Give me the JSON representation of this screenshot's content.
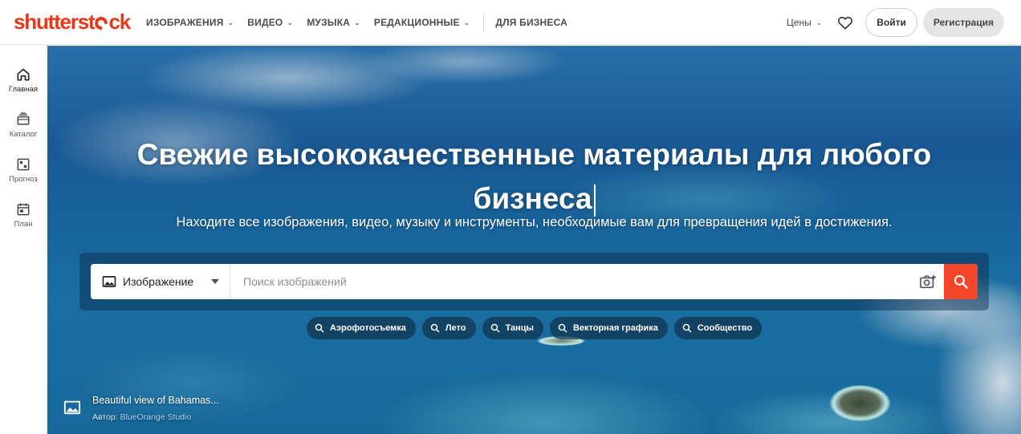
{
  "brand": {
    "logo_pre": "shutterst",
    "logo_post": "ck",
    "accent": "#e8381c"
  },
  "nav": {
    "items": [
      {
        "label": "ИЗОБРАЖЕНИЯ",
        "has_dropdown": true
      },
      {
        "label": "ВИДЕО",
        "has_dropdown": true
      },
      {
        "label": "МУЗЫКА",
        "has_dropdown": true
      },
      {
        "label": "РЕДАКЦИОННЫЕ",
        "has_dropdown": true
      },
      {
        "label": "ДЛЯ БИЗНЕСА",
        "has_dropdown": false
      }
    ],
    "prices_label": "Цены",
    "favorites_icon": "heart-icon",
    "login_label": "Войти",
    "register_label": "Регистрация"
  },
  "sidebar": {
    "items": [
      {
        "label": "Главная",
        "icon": "home-icon",
        "active": true
      },
      {
        "label": "Каталог",
        "icon": "catalog-icon",
        "active": false
      },
      {
        "label": "Прогноз",
        "icon": "forecast-icon",
        "active": false
      },
      {
        "label": "План",
        "icon": "plan-icon",
        "active": false
      }
    ]
  },
  "hero": {
    "title_line1": "Свежие высококачественные материалы для любого",
    "title_line2": "бизнеса",
    "subtitle": "Находите все изображения, видео, музыку и инструменты, необходимые вам для превращения идей в достижения."
  },
  "search": {
    "type_label": "Изображение",
    "placeholder": "Поиск изображений",
    "value": "",
    "search_button_color": "#f5452a"
  },
  "chips": [
    {
      "label": "Аэрофотосъемка"
    },
    {
      "label": "Лето"
    },
    {
      "label": "Танцы"
    },
    {
      "label": "Векторная графика"
    },
    {
      "label": "Сообщество"
    }
  ],
  "credit": {
    "title": "Beautiful view of Bahamas...",
    "author_prefix": "Автор:",
    "author_name": "BlueOrange Studio"
  }
}
